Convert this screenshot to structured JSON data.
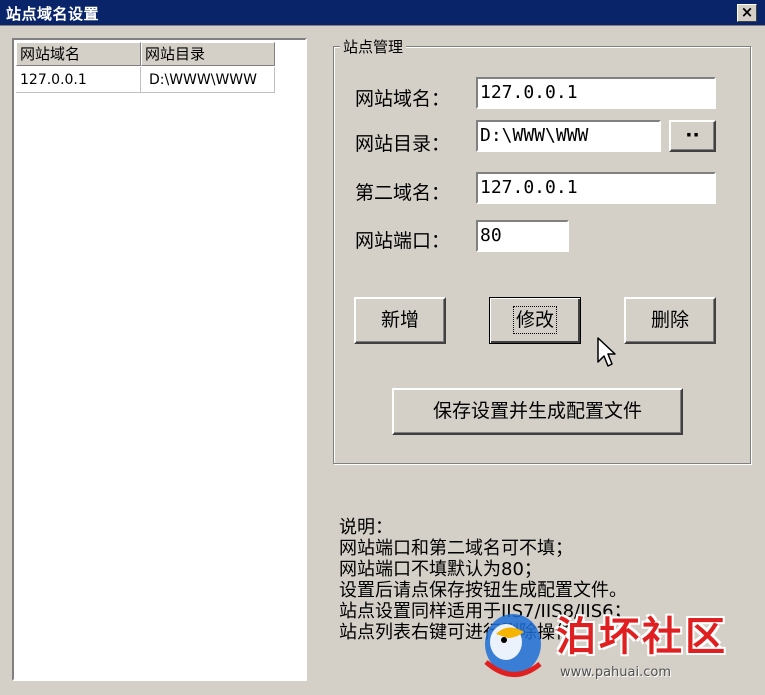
{
  "window": {
    "title": "站点域名设置",
    "close_glyph": "×"
  },
  "site_list": {
    "columns": [
      "网站域名",
      "网站目录"
    ],
    "rows": [
      {
        "domain": "127.0.0.1",
        "directory": "D:\\WWW\\WWW"
      }
    ]
  },
  "site_management": {
    "group_title": "站点管理",
    "fields": {
      "domain": {
        "label": "网站域名：",
        "value": "127.0.0.1"
      },
      "directory": {
        "label": "网站目录：",
        "value": "D:\\WWW\\WWW",
        "browse_label": "··"
      },
      "second_domain": {
        "label": "第二域名：",
        "value": "127.0.0.1"
      },
      "port": {
        "label": "网站端口：",
        "value": "80"
      }
    },
    "buttons": {
      "add": "新增",
      "modify": "修改",
      "delete": "删除",
      "save_generate": "保存设置并生成配置文件"
    }
  },
  "notes": {
    "title": "说明：",
    "lines": [
      "网站端口和第二域名可不填；",
      "网站端口不填默认为80；",
      "设置后请点保存按钮生成配置文件。",
      "站点设置同样适用于IIS7/IIS8/IIS6；",
      "站点列表右键可进行删除操作。"
    ]
  },
  "watermark": {
    "text": "泊坏社区",
    "url": "www.pahuai.com",
    "icon": "parrot-logo"
  },
  "colors": {
    "titlebar": "#0a246a",
    "face": "#d4d0c8",
    "watermark_red": "#e02020"
  }
}
